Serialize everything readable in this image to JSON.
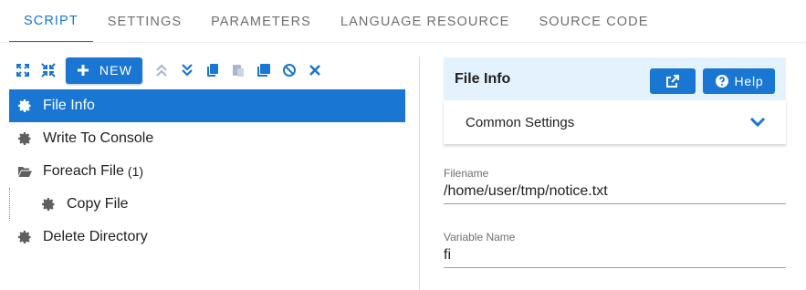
{
  "tabs": [
    {
      "label": "SCRIPT",
      "active": true
    },
    {
      "label": "SETTINGS",
      "active": false
    },
    {
      "label": "PARAMETERS",
      "active": false
    },
    {
      "label": "LANGUAGE RESOURCE",
      "active": false
    },
    {
      "label": "SOURCE CODE",
      "active": false
    }
  ],
  "toolbar": {
    "new_label": "NEW",
    "icons": [
      "expand-all-icon",
      "collapse-all-icon",
      "plus-icon",
      "move-up-icon",
      "move-down-icon",
      "copy-icon",
      "paste-icon",
      "duplicate-icon",
      "disable-icon",
      "delete-icon"
    ]
  },
  "tree": {
    "items": [
      {
        "label": "File Info",
        "icon": "gear-icon",
        "selected": true
      },
      {
        "label": "Write To Console",
        "icon": "gear-icon"
      },
      {
        "label": "Foreach File",
        "count": "(1)",
        "icon": "folder-open-icon"
      },
      {
        "label": "Copy File",
        "icon": "gear-icon",
        "child": true
      },
      {
        "label": "Delete Directory",
        "icon": "gear-icon"
      }
    ]
  },
  "panel": {
    "title": "File Info",
    "help_label": "Help",
    "common_settings_label": "Common Settings"
  },
  "fields": [
    {
      "label": "Filename",
      "value": "/home/user/tmp/notice.txt"
    },
    {
      "label": "Variable Name",
      "value": "fi"
    }
  ],
  "colors": {
    "accent": "#1976d2",
    "header_bg": "#e3f2fd"
  }
}
